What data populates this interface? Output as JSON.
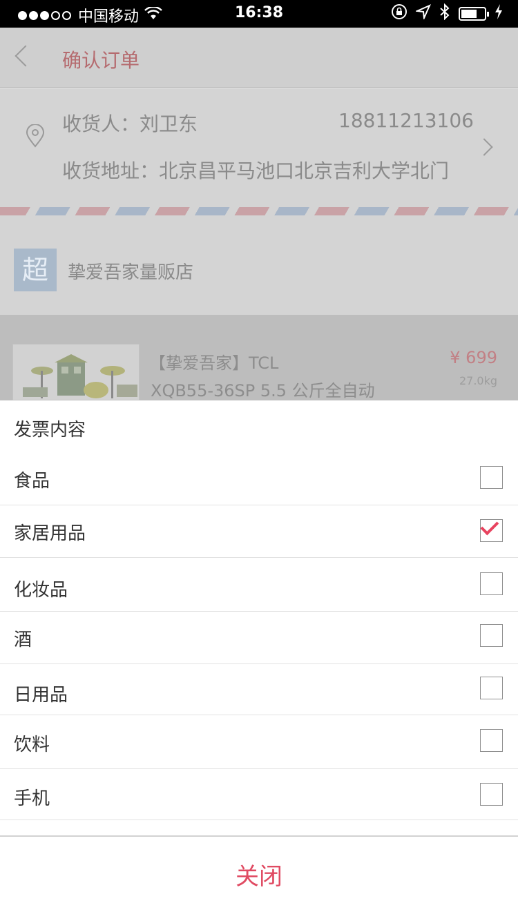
{
  "status_bar": {
    "carrier": "中国移动",
    "time": "16:38"
  },
  "nav": {
    "title": "确认订单"
  },
  "address": {
    "recipient": "收货人：刘卫东",
    "phone": "18811213106",
    "line": "收货地址：北京昌平马池口北京吉利大学北门"
  },
  "store": {
    "badge": "超",
    "name": "挚爱吾家量贩店"
  },
  "product": {
    "title_line1": "【挚爱吾家】TCL",
    "title_line2": "XQB55-36SP 5.5 公斤全自动",
    "price": "¥ 699",
    "weight": "27.0kg"
  },
  "sheet": {
    "title": "发票内容",
    "options": [
      {
        "label": "食品",
        "checked": false
      },
      {
        "label": "家居用品",
        "checked": true
      },
      {
        "label": "化妆品",
        "checked": false
      },
      {
        "label": "酒",
        "checked": false
      },
      {
        "label": "日用品",
        "checked": false
      },
      {
        "label": "饮料",
        "checked": false
      },
      {
        "label": "手机",
        "checked": false
      }
    ],
    "close_label": "关闭"
  },
  "colors": {
    "accent": "#e8435f",
    "close_text": "#e04a62",
    "nav_title": "#b56b6f"
  }
}
